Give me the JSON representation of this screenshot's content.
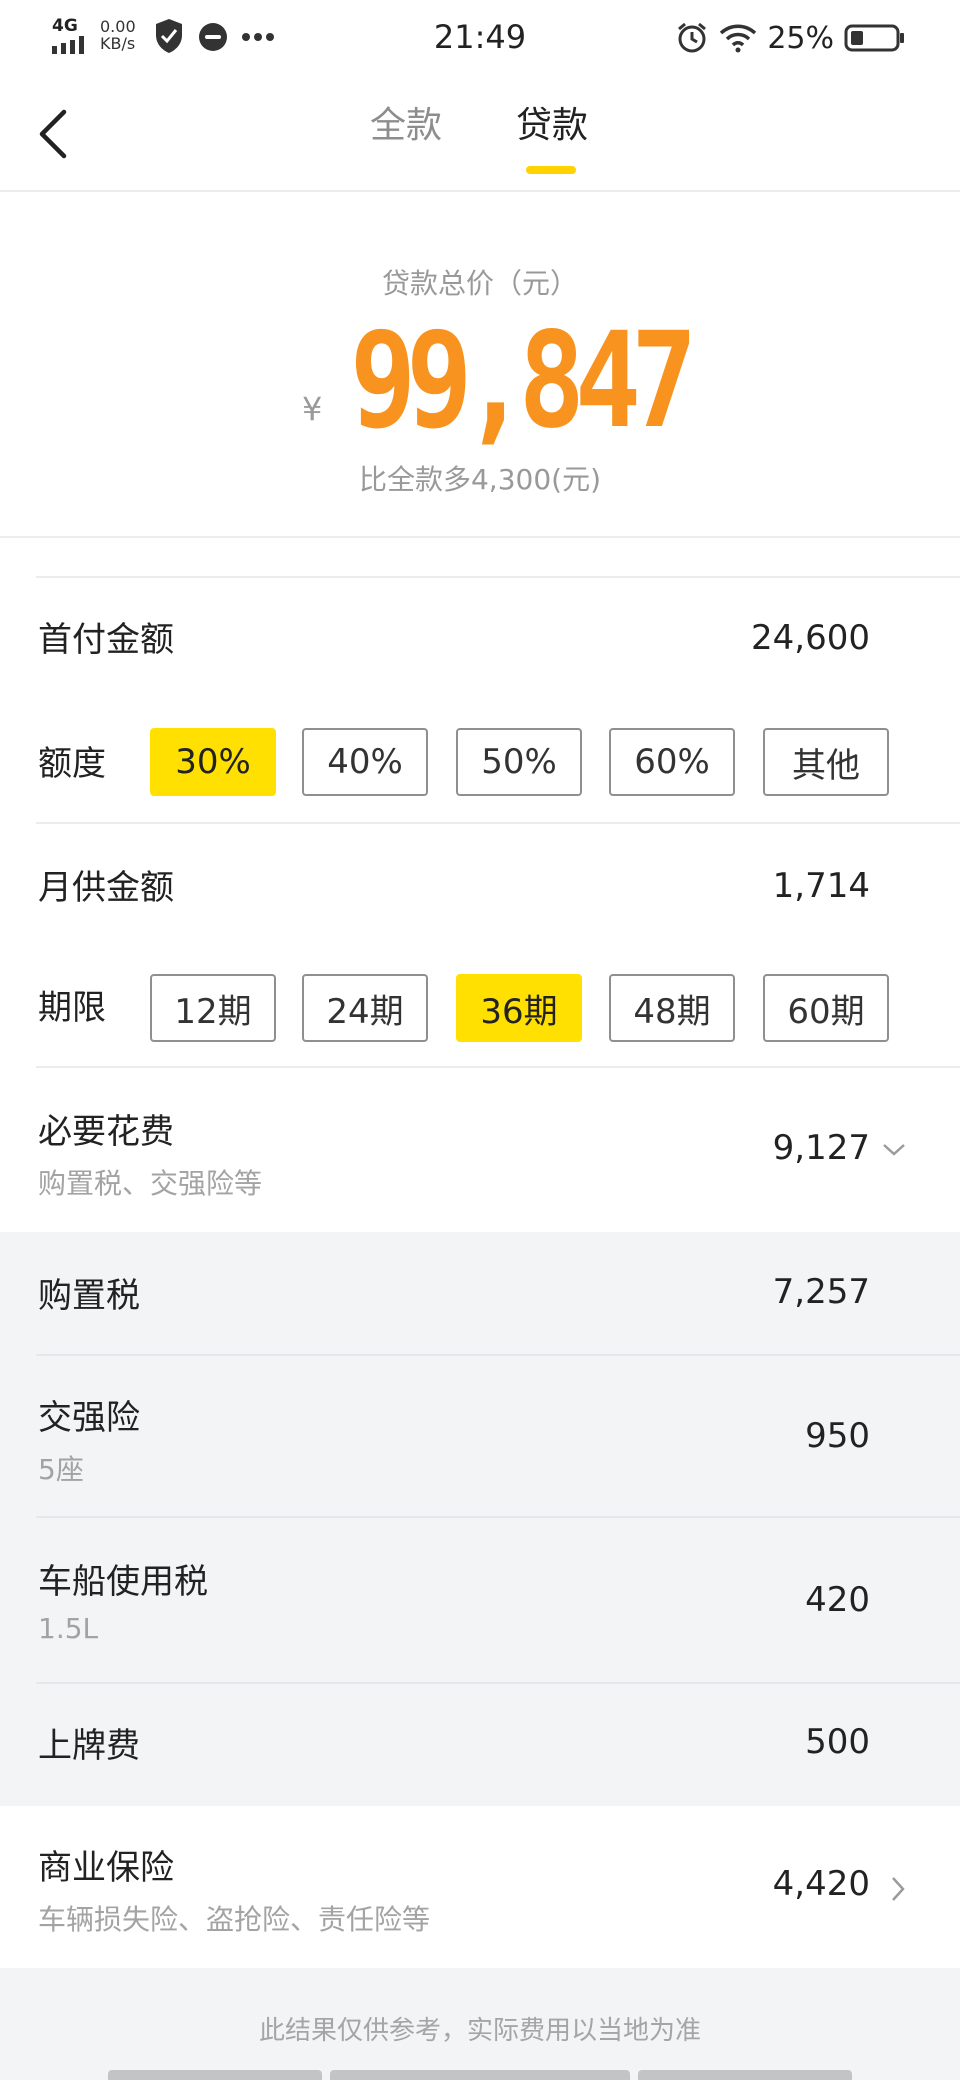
{
  "status": {
    "network": "4G",
    "speed_value": "0.00",
    "speed_unit": "KB/s",
    "time": "21:49",
    "battery": "25%"
  },
  "nav": {
    "tab_full": "全款",
    "tab_loan": "贷款"
  },
  "summary": {
    "label": "贷款总价（元）",
    "currency": "¥",
    "total": "99,847",
    "compare": "比全款多4,300(元)"
  },
  "down_payment": {
    "label": "首付金额",
    "value": "24,600",
    "ratio_label": "额度",
    "ratios": [
      "30%",
      "40%",
      "50%",
      "60%",
      "其他"
    ],
    "selected": "30%"
  },
  "monthly": {
    "label": "月供金额",
    "value": "1,714",
    "term_label": "期限",
    "terms": [
      "12期",
      "24期",
      "36期",
      "48期",
      "60期"
    ],
    "selected": "36期"
  },
  "necessary": {
    "label": "必要花费",
    "sub": "购置税、交强险等",
    "value": "9,127",
    "items": [
      {
        "label": "购置税",
        "sub": "",
        "value": "7,257"
      },
      {
        "label": "交强险",
        "sub": "5座",
        "value": "950"
      },
      {
        "label": "车船使用税",
        "sub": "1.5L",
        "value": "420"
      },
      {
        "label": "上牌费",
        "sub": "",
        "value": "500"
      }
    ]
  },
  "insurance": {
    "label": "商业保险",
    "sub": "车辆损失险、盗抢险、责任险等",
    "value": "4,420"
  },
  "footer": {
    "note": "此结果仅供参考，实际费用以当地为准"
  }
}
